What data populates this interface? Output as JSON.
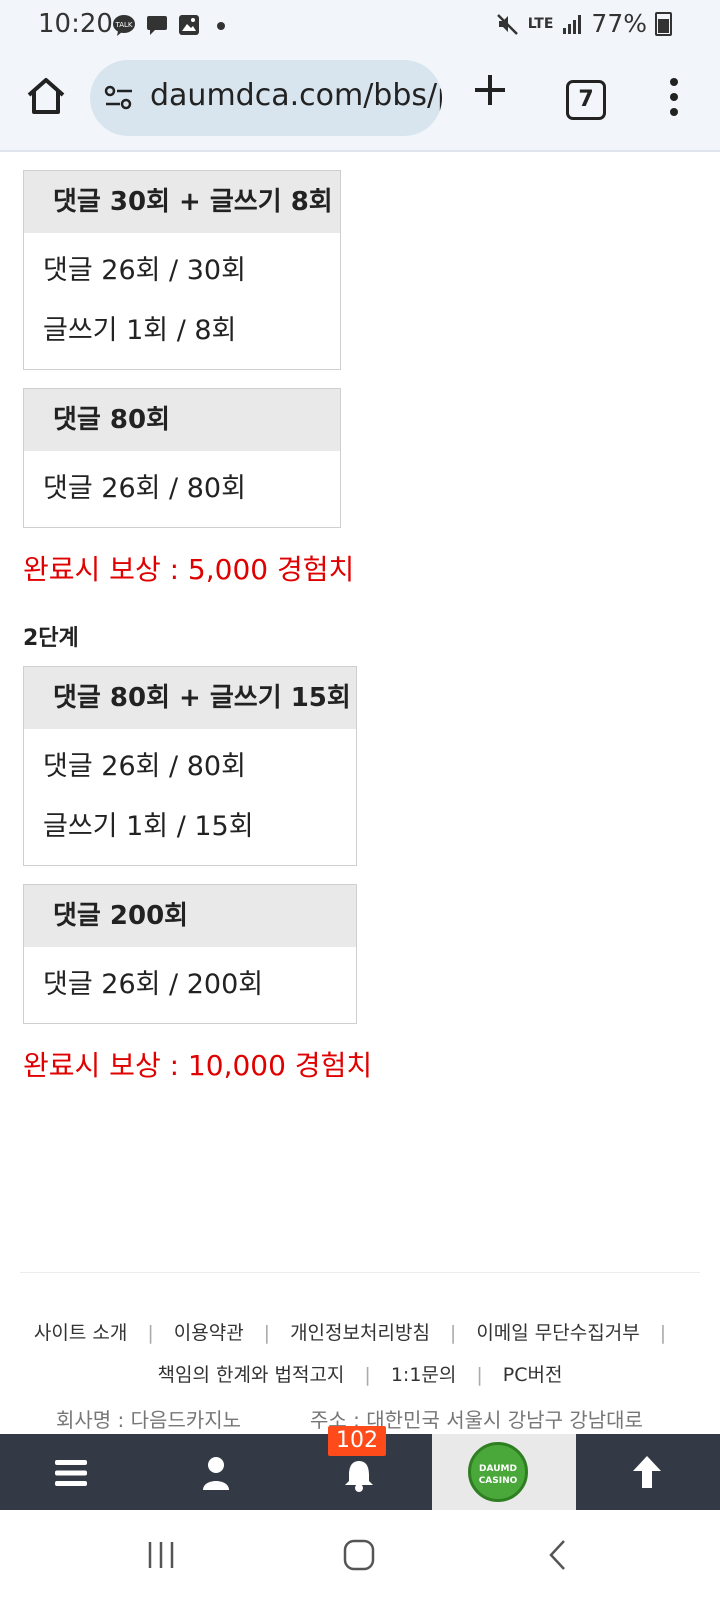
{
  "status_bar": {
    "time": "10:20",
    "network": "LTE",
    "battery": "77%"
  },
  "browser": {
    "url": "daumdca.com/bbs/p",
    "tab_count": "7"
  },
  "stage1": {
    "box1": {
      "title": "댓글 30회 + 글쓰기 8회",
      "line1": "댓글 26회 / 30회",
      "line2": "글쓰기 1회 / 8회"
    },
    "box2": {
      "title": "댓글 80회",
      "line1": "댓글 26회 / 80회"
    },
    "reward": "완료시 보상 : 5,000 경험치"
  },
  "stage2": {
    "label": "2단계",
    "box1": {
      "title": "댓글 80회 + 글쓰기 15회",
      "line1": "댓글 26회 / 80회",
      "line2": "글쓰기 1회 / 15회"
    },
    "box2": {
      "title": "댓글 200회",
      "line1": "댓글 26회 / 200회"
    },
    "reward": "완료시 보상 : 10,000 경험치"
  },
  "footer": {
    "links_row1": [
      "사이트 소개",
      "이용약관",
      "개인정보처리방침",
      "이메일 무단수집거부"
    ],
    "links_row2": [
      "책임의 한계와 법적고지",
      "1:1문의",
      "PC버전"
    ],
    "company": "회사명 : 다음드카지노",
    "address": "주소 : 대한민국 서울시 강남구 강남대로"
  },
  "app_nav": {
    "notification_count": "102",
    "logo_text": "DAUMD CASINO"
  },
  "colors": {
    "reward_red": "#e00000",
    "nav_bg": "#333a45",
    "badge_orange": "#ff4a1a"
  }
}
